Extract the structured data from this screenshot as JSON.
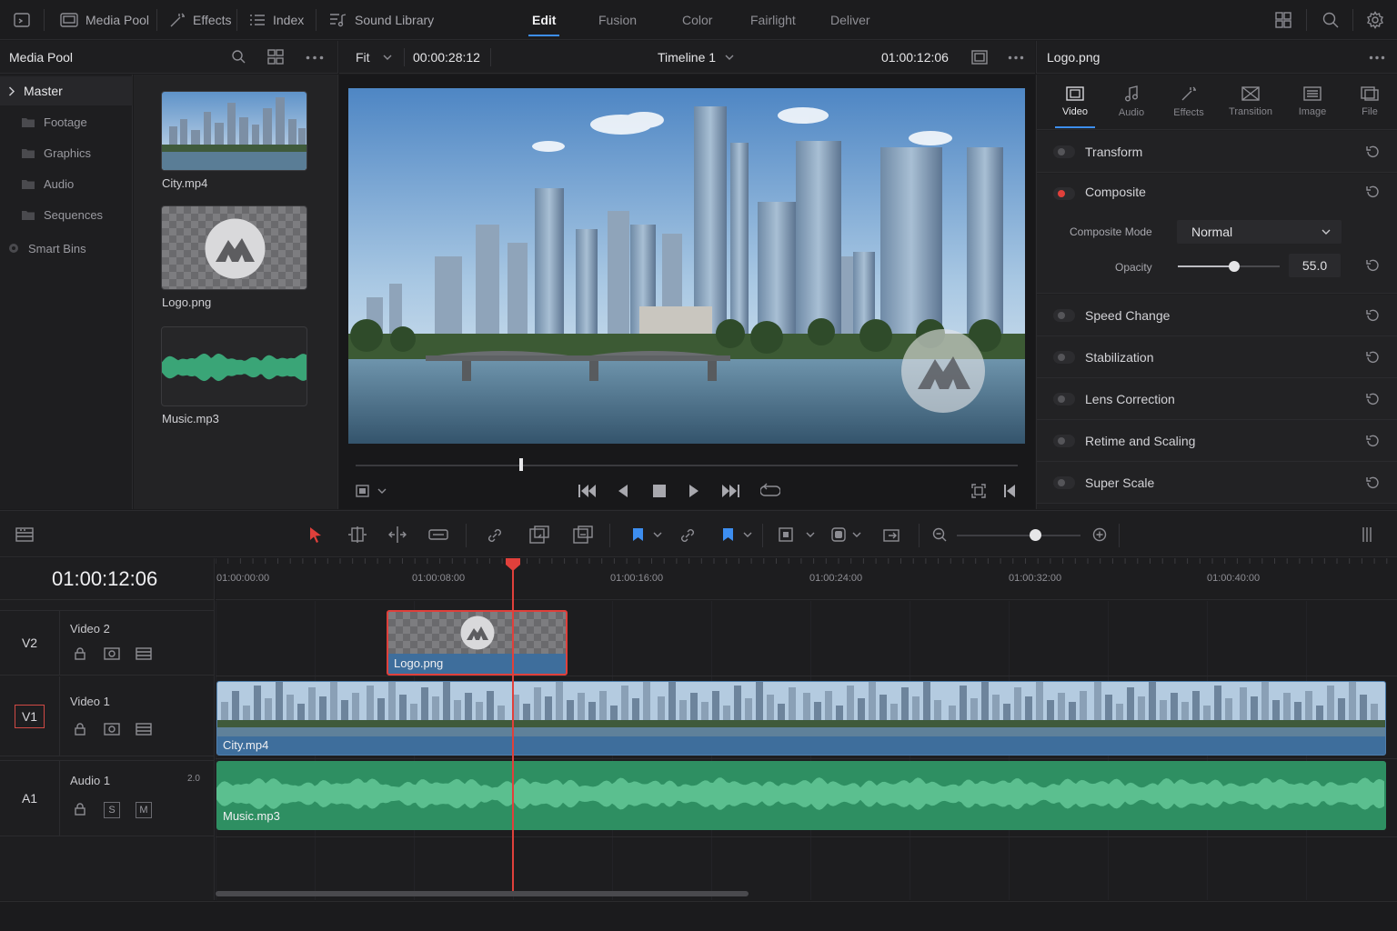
{
  "topbar": {
    "media_pool": "Media Pool",
    "effects": "Effects",
    "index": "Index",
    "sound_library": "Sound Library",
    "pages": [
      "Edit",
      "Fusion",
      "Color",
      "Fairlight",
      "Deliver"
    ],
    "active_page": "Edit"
  },
  "media_pool": {
    "title": "Media Pool",
    "bins": [
      {
        "label": "Master",
        "icon": "chevron-right-icon"
      },
      {
        "label": "Footage",
        "icon": "folder-icon"
      },
      {
        "label": "Graphics",
        "icon": "folder-icon"
      },
      {
        "label": "Audio",
        "icon": "folder-icon"
      },
      {
        "label": "Sequences",
        "icon": "folder-icon"
      },
      {
        "label": "Smart Bins",
        "icon": "smart-bin-icon"
      }
    ],
    "clips": [
      {
        "name": "City.mp4"
      },
      {
        "name": "Logo.png"
      },
      {
        "name": "Music.mp3"
      }
    ]
  },
  "viewer": {
    "zoom": "Fit",
    "duration": "00:00:28:12",
    "timeline_name": "Timeline 1",
    "timecode": "01:00:12:06",
    "scrubber_position": 0.25
  },
  "inspector": {
    "clip_name": "Logo.png",
    "tabs": [
      "Video",
      "Audio",
      "Effects",
      "Transition",
      "Image",
      "File"
    ],
    "active_tab": "Video",
    "sections": {
      "transform": "Transform",
      "composite": "Composite",
      "speed_change": "Speed Change",
      "stabilization": "Stabilization",
      "lens_correction": "Lens Correction",
      "retime": "Retime and Scaling",
      "super_scale": "Super Scale"
    },
    "composite_mode_label": "Composite Mode",
    "composite_mode_value": "Normal",
    "opacity_label": "Opacity",
    "opacity_value": "55.0",
    "opacity_fraction": 0.55
  },
  "timeline": {
    "timecode": "01:00:12:06",
    "ruler": [
      "01:00:00:00",
      "01:00:08:00",
      "01:00:16:00",
      "01:00:24:00",
      "01:00:32:00",
      "01:00:40:00"
    ],
    "tracks": [
      {
        "id": "V2",
        "name": "Video 2"
      },
      {
        "id": "V1",
        "name": "Video 1"
      },
      {
        "id": "A1",
        "name": "Audio 1",
        "channels": "2.0",
        "solo": "S",
        "mute": "M"
      }
    ],
    "clips": {
      "logo": "Logo.png",
      "city": "City.mp4",
      "music": "Music.mp3"
    }
  },
  "colors": {
    "accent": "#3d8ef0",
    "playhead": "#e0403b",
    "video_clip": "#3e6e9c",
    "audio_clip": "#2e8f62"
  }
}
